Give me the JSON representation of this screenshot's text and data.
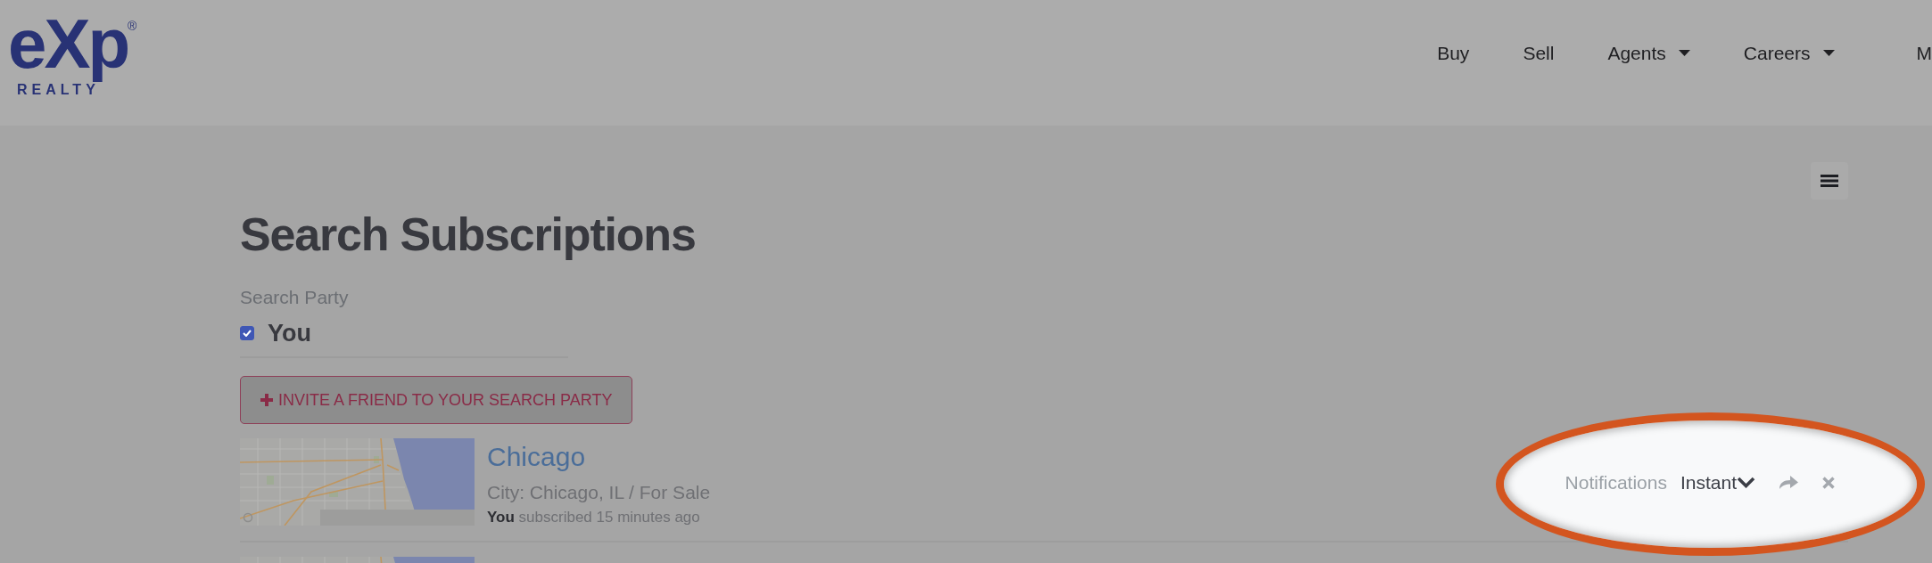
{
  "header": {
    "logo": {
      "wordmark": "eXp$^{®}$",
      "tagline": "REALTY"
    },
    "nav": [
      {
        "label": "Buy",
        "dropdown": false
      },
      {
        "label": "Sell",
        "dropdown": false
      },
      {
        "label": "Agents",
        "dropdown": true
      },
      {
        "label": "Careers",
        "dropdown": true
      },
      {
        "label": "M",
        "dropdown": false
      }
    ]
  },
  "page": {
    "title": "Search Subscriptions",
    "search_party": {
      "label": "Search Party",
      "members": [
        {
          "name": "You",
          "checked": true
        }
      ],
      "invite_button": "INVITE A FRIEND TO YOUR SEARCH PARTY"
    }
  },
  "subscriptions": [
    {
      "kind": "map",
      "title": "Chicago",
      "criteria": "City: Chicago, IL / For Sale",
      "status": "**You** subscribed 15 minutes ago",
      "notifications_label": "Notifications",
      "frequency": "Instant",
      "highlighted": true
    },
    {
      "kind": "map",
      "highlighted": false
    }
  ]
}
